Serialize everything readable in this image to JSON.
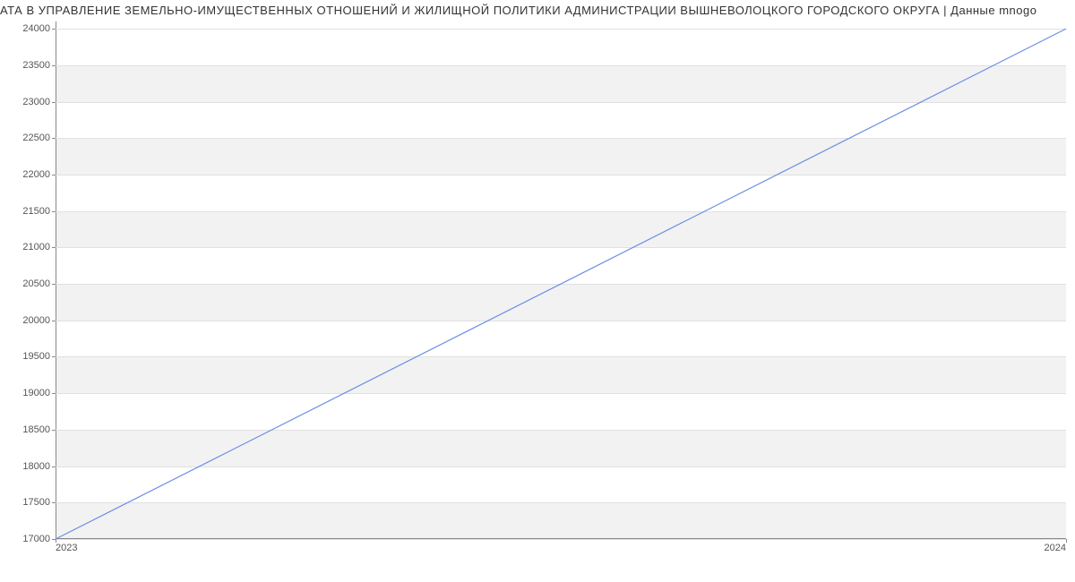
{
  "title": "АТА В УПРАВЛЕНИЕ ЗЕМЕЛЬНО-ИМУЩЕСТВЕННЫХ ОТНОШЕНИЙ И ЖИЛИЩНОЙ ПОЛИТИКИ АДМИНИСТРАЦИИ ВЫШНЕВОЛОЦКОГО ГОРОДСКОГО ОКРУГА | Данные mnogo",
  "chart_data": {
    "type": "line",
    "x": [
      2023,
      2024
    ],
    "values": [
      17000,
      24000
    ],
    "y_ticks": [
      17000,
      17500,
      18000,
      18500,
      19000,
      19500,
      20000,
      20500,
      21000,
      21500,
      22000,
      22500,
      23000,
      23500,
      24000
    ],
    "x_ticks": [
      2023,
      2024
    ],
    "ylim": [
      17000,
      24100
    ],
    "xlim": [
      2023,
      2024
    ],
    "line_color": "#6c8ee6",
    "title": "АТА В УПРАВЛЕНИЕ ЗЕМЕЛЬНО-ИМУЩЕСТВЕННЫХ ОТНОШЕНИЙ И ЖИЛИЩНОЙ ПОЛИТИКИ АДМИНИСТРАЦИИ ВЫШНЕВОЛОЦКОГО ГОРОДСКОГО ОКРУГА | Данные mnogo",
    "xlabel": "",
    "ylabel": ""
  }
}
